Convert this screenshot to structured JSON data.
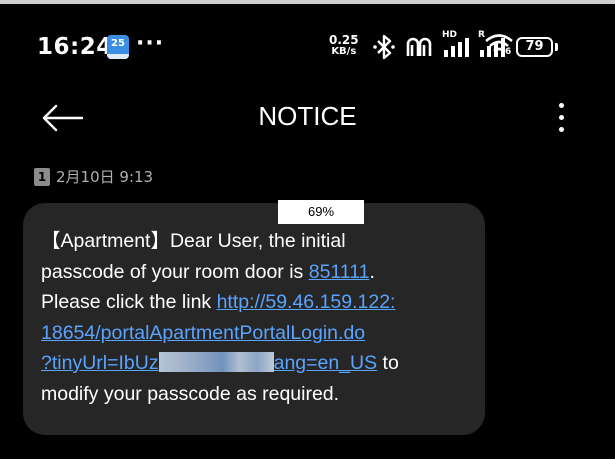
{
  "status_bar": {
    "time": "16:24",
    "calendar_day": "25",
    "more_notifications": "···",
    "net_speed_value": "0.25",
    "net_speed_unit": "KB/s",
    "signal1_badge": "HD",
    "signal2_badge": "R",
    "wifi_badge": "6",
    "battery_level": "79"
  },
  "app_bar": {
    "title": "NOTICE"
  },
  "message": {
    "sim_slot": "1",
    "timestamp": "2月10日 9:13",
    "overlay_percent": "69%",
    "line1": "【Apartment】Dear User, the initial",
    "line2_text": "passcode of your room door is ",
    "passcode": "851111",
    "line2_end": ".",
    "line3_text": "Please click the link ",
    "link_part1": "http://59.46.159.122:",
    "link_part2": "18654/portalApartmentPortalLogin.do",
    "link_part3a": "?tinyUrl=IbUz",
    "link_part3b": "ang=en_US",
    "line5_end": " to",
    "line6": "modify your passcode as required."
  },
  "colors": {
    "background": "#000000",
    "bubble": "#262626",
    "link": "#5aa3ff",
    "meta_text": "#b0b0b0"
  }
}
